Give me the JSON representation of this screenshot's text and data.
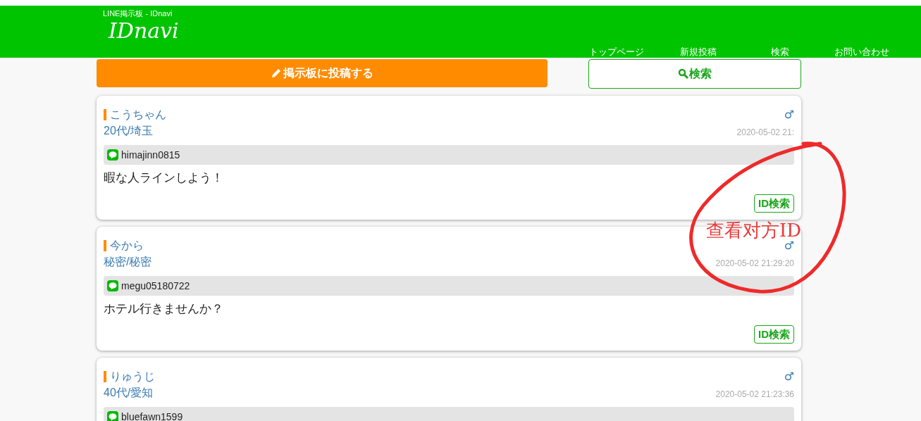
{
  "header": {
    "subtitle": "LINE掲示板 - IDnavi",
    "logo": "IDnavi",
    "nav": [
      "トップページ",
      "新規投稿",
      "検索",
      "お問い合わせ"
    ]
  },
  "actions": {
    "post_button": "掲示板に投稿する",
    "search_button": "検索"
  },
  "posts": [
    {
      "name": "こうちゃん",
      "profile": "20代/埼玉",
      "gender": "♂",
      "time": "2020-05-02 21:",
      "line_id": "himajinn0815",
      "message": "暇な人ラインしよう！",
      "id_search": "ID検索"
    },
    {
      "name": "今から",
      "profile": "秘密/秘密",
      "gender": "♂",
      "time": "2020-05-02 21:29:20",
      "line_id": "megu05180722",
      "message": "ホテル行きませんか？",
      "id_search": "ID検索"
    },
    {
      "name": "りゅうじ",
      "profile": "40代/愛知",
      "gender": "♂",
      "time": "2020-05-02 21:23:36",
      "line_id": "bluefawn1599"
    }
  ],
  "annotation": {
    "text": "查看对方ID"
  }
}
